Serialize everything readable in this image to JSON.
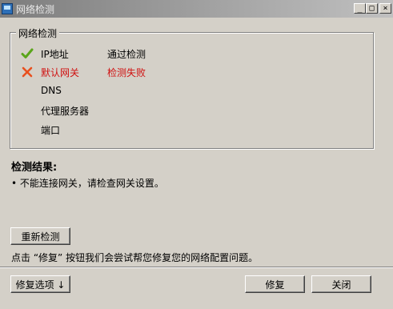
{
  "window": {
    "title": "网络检测",
    "minimize_glyph": "_",
    "maximize_glyph": "□",
    "close_glyph": "×"
  },
  "group": {
    "legend": "网络检测",
    "items": [
      {
        "name": "IP地址",
        "status": "pass",
        "result": "通过检测",
        "icon": "checkmark-icon"
      },
      {
        "name": "默认网关",
        "status": "fail",
        "result": "检测失败",
        "icon": "cross-icon"
      },
      {
        "name": "DNS",
        "status": "none",
        "result": ""
      },
      {
        "name": "代理服务器",
        "status": "none",
        "result": ""
      },
      {
        "name": "端口",
        "status": "none",
        "result": ""
      }
    ]
  },
  "results": {
    "heading": "检测结果:",
    "line": "• 不能连接网关，请检查网关设置。"
  },
  "buttons": {
    "retest": "重新检测",
    "repair_options": "修复选项 ↓",
    "repair": "修复",
    "close": "关闭"
  },
  "hint": "点击 “修复” 按钮我们会尝试帮您修复您的网络配置问题。",
  "colors": {
    "pass": "#5aa51a",
    "fail": "#e8501e",
    "error_text": "#d01010",
    "dialog_bg": "#d4d0c8"
  }
}
